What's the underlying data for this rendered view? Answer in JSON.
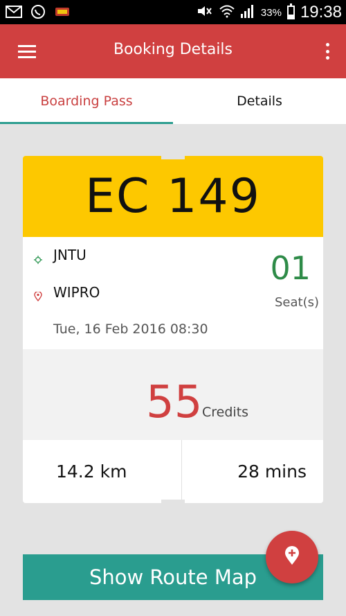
{
  "status_bar": {
    "battery": "33%",
    "time": "19:38",
    "icons": [
      "mail-icon",
      "whatsapp-icon",
      "app-icon",
      "mute-icon",
      "wifi-icon",
      "signal-icon",
      "battery-icon"
    ]
  },
  "app_bar": {
    "title": "Booking Details",
    "menu_icon": "hamburger-menu-icon",
    "more_icon": "more-vertical-icon"
  },
  "tabs": [
    {
      "label": "Boarding Pass",
      "active": true
    },
    {
      "label": "Details",
      "active": false
    }
  ],
  "ticket": {
    "vehicle_number": "EC 149",
    "from": "JNTU",
    "to": "WIPRO",
    "datetime": "Tue, 16 Feb 2016 08:30",
    "seats": "01",
    "seats_label": "Seat(s)",
    "credits": "55",
    "credits_label": "Credits",
    "distance": "14.2 km",
    "duration": "28 mins"
  },
  "actions": {
    "route_map_label": "Show Route Map",
    "fab_icon": "add-location-icon"
  },
  "colors": {
    "primary": "#d04040",
    "accent": "#2a9d8f",
    "ticket_header": "#fdc800",
    "seats": "#2e8b48"
  }
}
